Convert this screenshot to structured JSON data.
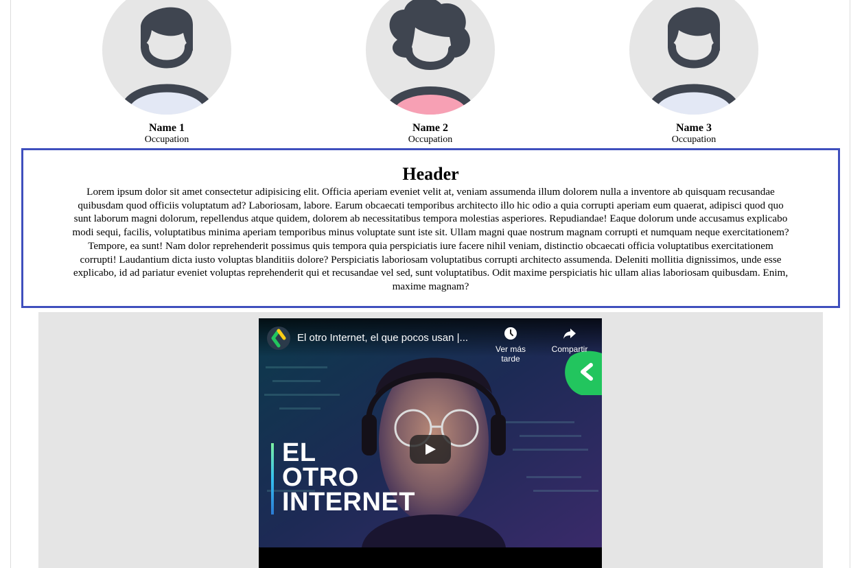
{
  "team": {
    "members": [
      {
        "name": "Name 1",
        "occupation": "Occupation",
        "avatar_icon": "male-avatar-icon",
        "shirt_color": "#e3e8f5"
      },
      {
        "name": "Name 2",
        "occupation": "Occupation",
        "avatar_icon": "female-avatar-icon",
        "shirt_color": "#f7a0b4"
      },
      {
        "name": "Name 3",
        "occupation": "Occupation",
        "avatar_icon": "male-avatar-icon",
        "shirt_color": "#e3e8f5"
      }
    ]
  },
  "info": {
    "header": "Header",
    "body": "Lorem ipsum dolor sit amet consectetur adipisicing elit. Officia aperiam eveniet velit at, veniam assumenda illum dolorem nulla a inventore ab quisquam recusandae quibusdam quod officiis voluptatum ad? Laboriosam, labore. Earum obcaecati temporibus architecto illo hic odio a quia corrupti aperiam eum quaerat, adipisci quod quo sunt laborum magni dolorum, repellendus atque quidem, dolorem ab necessitatibus tempora molestias asperiores. Repudiandae! Eaque dolorum unde accusamus explicabo modi sequi, facilis, voluptatibus minima aperiam temporibus minus voluptate sunt iste sit. Ullam magni quae nostrum magnam corrupti et numquam neque exercitationem? Tempore, ea sunt! Nam dolor reprehenderit possimus quis tempora quia perspiciatis iure facere nihil veniam, distinctio obcaecati officia voluptatibus exercitationem corrupti! Laudantium dicta iusto voluptas blanditiis dolore? Perspiciatis laboriosam voluptatibus corrupti architecto assumenda. Deleniti mollitia dignissimos, unde esse explicabo, id ad pariatur eveniet voluptas reprehenderit qui et recusandae vel sed, sunt voluptatibus. Odit maxime perspiciatis hic ullam alias laboriosam quibusdam. Enim, maxime magnam?",
    "border_color": "#3f4fbd"
  },
  "video": {
    "title": "El otro Internet, el que pocos usan |...",
    "watch_later_label": "Ver más tarde",
    "share_label": "Compartir",
    "headline": [
      "EL",
      "OTRO",
      "INTERNET"
    ],
    "channel_icon": "edteam-logo-icon",
    "play_icon": "play-icon",
    "brand_color": "#22c55e",
    "section_background": "#e5e5e5"
  }
}
